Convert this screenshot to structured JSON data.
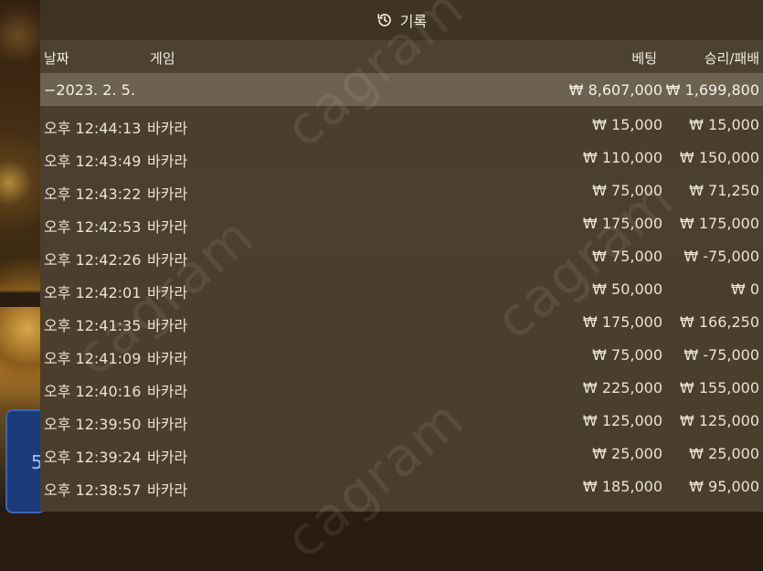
{
  "title": "기록",
  "icons": {
    "history": "history-icon"
  },
  "header": {
    "date": "날짜",
    "game": "게임",
    "bet": "베팅",
    "winloss": "승리/패배"
  },
  "date_group": {
    "date": "−2023. 2. 5.",
    "bet_total": "₩ 8,607,000",
    "win_total": "₩ 1,699,800"
  },
  "rows": [
    {
      "time": "오후 12:44:13",
      "game": "바카라",
      "bet": "₩ 15,000",
      "win": "₩ 15,000"
    },
    {
      "time": "오후 12:43:49",
      "game": "바카라",
      "bet": "₩ 110,000",
      "win": "₩ 150,000"
    },
    {
      "time": "오후 12:43:22",
      "game": "바카라",
      "bet": "₩ 75,000",
      "win": "₩ 71,250"
    },
    {
      "time": "오후 12:42:53",
      "game": "바카라",
      "bet": "₩ 175,000",
      "win": "₩ 175,000"
    },
    {
      "time": "오후 12:42:26",
      "game": "바카라",
      "bet": "₩ 75,000",
      "win": "₩ -75,000"
    },
    {
      "time": "오후 12:42:01",
      "game": "바카라",
      "bet": "₩ 50,000",
      "win": "₩ 0"
    },
    {
      "time": "오후 12:41:35",
      "game": "바카라",
      "bet": "₩ 175,000",
      "win": "₩ 166,250"
    },
    {
      "time": "오후 12:41:09",
      "game": "바카라",
      "bet": "₩ 75,000",
      "win": "₩ -75,000"
    },
    {
      "time": "오후 12:40:16",
      "game": "바카라",
      "bet": "₩ 225,000",
      "win": "₩ 155,000"
    },
    {
      "time": "오후 12:39:50",
      "game": "바카라",
      "bet": "₩ 125,000",
      "win": "₩ 125,000"
    },
    {
      "time": "오후 12:39:24",
      "game": "바카라",
      "bet": "₩ 25,000",
      "win": "₩ 25,000"
    },
    {
      "time": "오후 12:38:57",
      "game": "바카라",
      "bet": "₩ 185,000",
      "win": "₩ 95,000"
    }
  ],
  "watermark_text": "cagram",
  "background_chip_text": "5",
  "colors": {
    "panel": "#4a3d2d",
    "title_bar": "#3f3324",
    "date_row": "#6d6150",
    "text": "#ebe3d2"
  }
}
